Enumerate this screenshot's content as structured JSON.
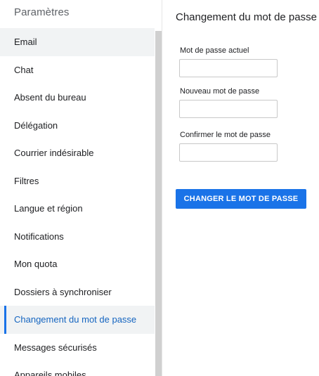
{
  "sidebar": {
    "title": "Paramètres",
    "items": [
      {
        "label": "Email"
      },
      {
        "label": "Chat"
      },
      {
        "label": "Absent du bureau"
      },
      {
        "label": "Délégation"
      },
      {
        "label": "Courrier indésirable"
      },
      {
        "label": "Filtres"
      },
      {
        "label": "Langue et région"
      },
      {
        "label": "Notifications"
      },
      {
        "label": "Mon quota"
      },
      {
        "label": "Dossiers à synchroniser"
      },
      {
        "label": "Changement du mot de passe"
      },
      {
        "label": "Messages sécurisés"
      },
      {
        "label": "Appareils mobiles"
      }
    ],
    "active_item": "Changement du mot de passe"
  },
  "main": {
    "title": "Changement du mot de passe",
    "fields": {
      "current": {
        "label": "Mot de passe actuel",
        "value": ""
      },
      "new": {
        "label": "Nouveau mot de passe",
        "value": ""
      },
      "confirm": {
        "label": "Confirmer le mot de passe",
        "value": ""
      }
    },
    "submit_label": "CHANGER LE MOT DE PASSE"
  },
  "colors": {
    "accent": "#1a73e8",
    "selected_background": "#f1f3f4"
  }
}
